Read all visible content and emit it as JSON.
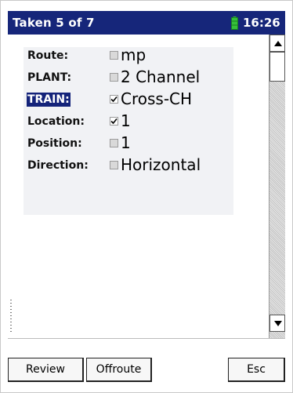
{
  "titlebar": {
    "title": "Taken 5 of 7",
    "time": "16:26",
    "battery_icon": "battery-icon",
    "battery_color": "#35c03a"
  },
  "colors": {
    "titlebar_bg": "#16267a",
    "highlight_bg": "#14237a",
    "panel_bg": "#f1f2f5"
  },
  "fields": [
    {
      "label": "Route:",
      "value": "mp",
      "checked": false,
      "highlighted": false
    },
    {
      "label": "PLANT:",
      "value": "2 Channel",
      "checked": false,
      "highlighted": false
    },
    {
      "label": "TRAIN:",
      "value": "Cross-CH",
      "checked": true,
      "highlighted": true
    },
    {
      "label": "Location:",
      "value": "1",
      "checked": true,
      "highlighted": false
    },
    {
      "label": "Position:",
      "value": "1",
      "checked": false,
      "highlighted": false
    },
    {
      "label": "Direction:",
      "value": "Horizontal",
      "checked": false,
      "highlighted": false
    }
  ],
  "buttons": {
    "review": "Review",
    "offroute": "Offroute",
    "esc": "Esc"
  }
}
